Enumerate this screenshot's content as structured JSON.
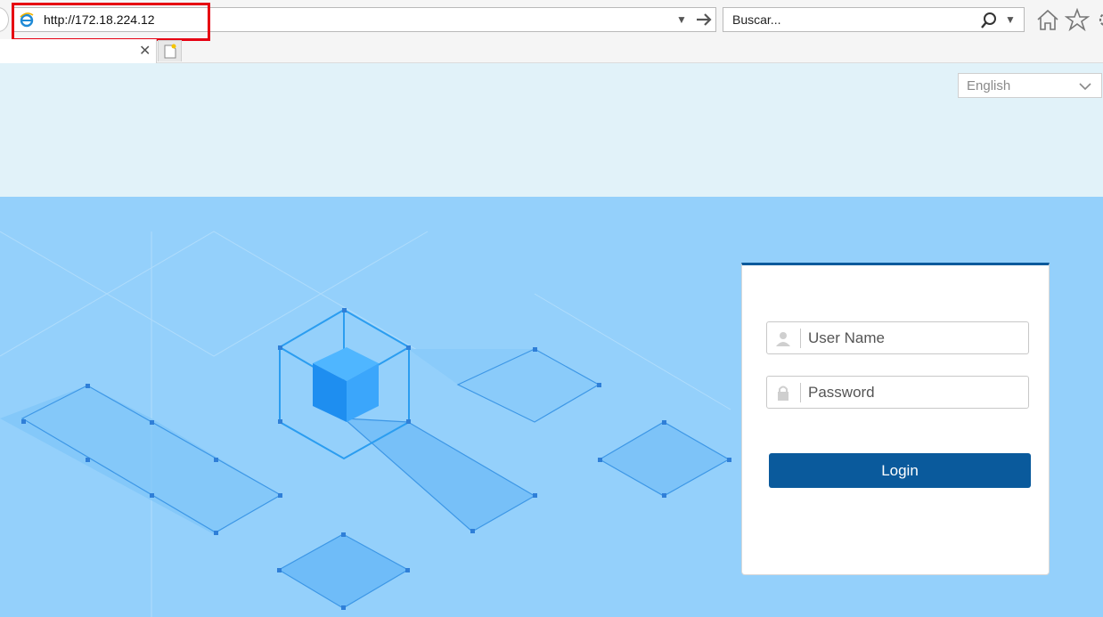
{
  "browser": {
    "url": "http://172.18.224.12",
    "search_placeholder": "Buscar..."
  },
  "page": {
    "language": "English",
    "login": {
      "username_placeholder": "User Name",
      "password_placeholder": "Password",
      "login_label": "Login"
    }
  },
  "colors": {
    "header_bg": "#e1f2f9",
    "hero_bg": "#94d0fb",
    "brand_blue": "#0a5a9c",
    "highlight_red": "#e60012"
  }
}
